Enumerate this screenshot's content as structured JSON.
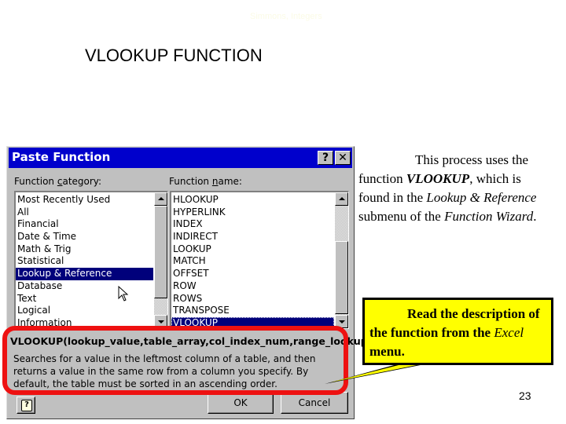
{
  "slide": {
    "header_ghost": "Simmons, Integers",
    "title": "VLOOKUP FUNCTION",
    "page_number": "23"
  },
  "dialog": {
    "title": "Paste Function",
    "help_button": "?",
    "close_button": "✕",
    "category_label_pre": "Function ",
    "category_label_u": "c",
    "category_label_post": "ategory:",
    "name_label_pre": "Function ",
    "name_label_u": "n",
    "name_label_post": "ame:",
    "categories": [
      {
        "label": "Most Recently Used",
        "selected": false
      },
      {
        "label": "All",
        "selected": false
      },
      {
        "label": "Financial",
        "selected": false
      },
      {
        "label": "Date & Time",
        "selected": false
      },
      {
        "label": "Math & Trig",
        "selected": false
      },
      {
        "label": "Statistical",
        "selected": false
      },
      {
        "label": "Lookup & Reference",
        "selected": true
      },
      {
        "label": "Database",
        "selected": false
      },
      {
        "label": "Text",
        "selected": false
      },
      {
        "label": "Logical",
        "selected": false
      },
      {
        "label": "Information",
        "selected": false
      }
    ],
    "functions": [
      {
        "label": "HLOOKUP",
        "selected": false
      },
      {
        "label": "HYPERLINK",
        "selected": false
      },
      {
        "label": "INDEX",
        "selected": false
      },
      {
        "label": "INDIRECT",
        "selected": false
      },
      {
        "label": "LOOKUP",
        "selected": false
      },
      {
        "label": "MATCH",
        "selected": false
      },
      {
        "label": "OFFSET",
        "selected": false
      },
      {
        "label": "ROW",
        "selected": false
      },
      {
        "label": "ROWS",
        "selected": false
      },
      {
        "label": "TRANSPOSE",
        "selected": false
      },
      {
        "label": "VLOOKUP",
        "selected": true
      }
    ],
    "syntax": "VLOOKUP(lookup_value,table_array,col_index_num,range_lookup)",
    "description": "Searches for a value in the leftmost column of a table, and then returns a value in the same row from a column you specify. By default, the table must be sorted in an ascending order.",
    "help_icon": "?",
    "ok_label": "OK",
    "cancel_label": "Cancel"
  },
  "info_text": {
    "p1": "This process uses the function ",
    "fn": "VLOOKUP",
    "p2": ", which is found in the ",
    "submenu": "Lookup & Reference",
    "p3": " submenu of the ",
    "wizard": "Function Wizard",
    "p4": "."
  },
  "callout": {
    "p1": "Read the description of the function from the ",
    "app": "Excel",
    "p2": " menu."
  },
  "colors": {
    "title_bar": "#0000cc",
    "selection": "#00007b",
    "highlight_ring": "#ee1111",
    "callout_bg": "#ffff00"
  }
}
